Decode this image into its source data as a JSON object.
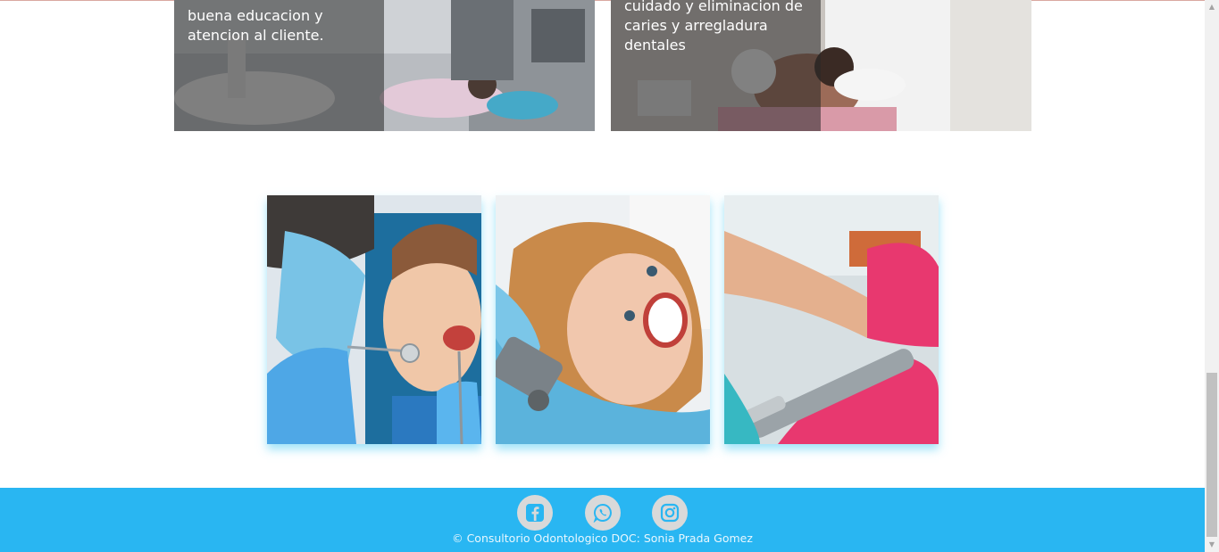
{
  "services": [
    {
      "text": "buena educacion y atencion al cliente."
    },
    {
      "text": "cuidado y eliminacion de caries y arregladura dentales"
    }
  ],
  "gallery": [
    {
      "subject": "dentist examining boy with mirror"
    },
    {
      "subject": "smiling girl in dental chair"
    },
    {
      "subject": "dental drill with pink gloves"
    }
  ],
  "footer": {
    "social": [
      {
        "icon": "facebook-icon"
      },
      {
        "icon": "whatsapp-icon"
      },
      {
        "icon": "instagram-icon"
      }
    ],
    "copyright": "© Consultorio Odontologico DOC: Sonia Prada Gomez"
  },
  "colors": {
    "footer_bg": "#29b6f2",
    "social_circle": "#d9d9d9",
    "icon": "#29b6f2",
    "gallery_glow": "#78d7f5"
  }
}
